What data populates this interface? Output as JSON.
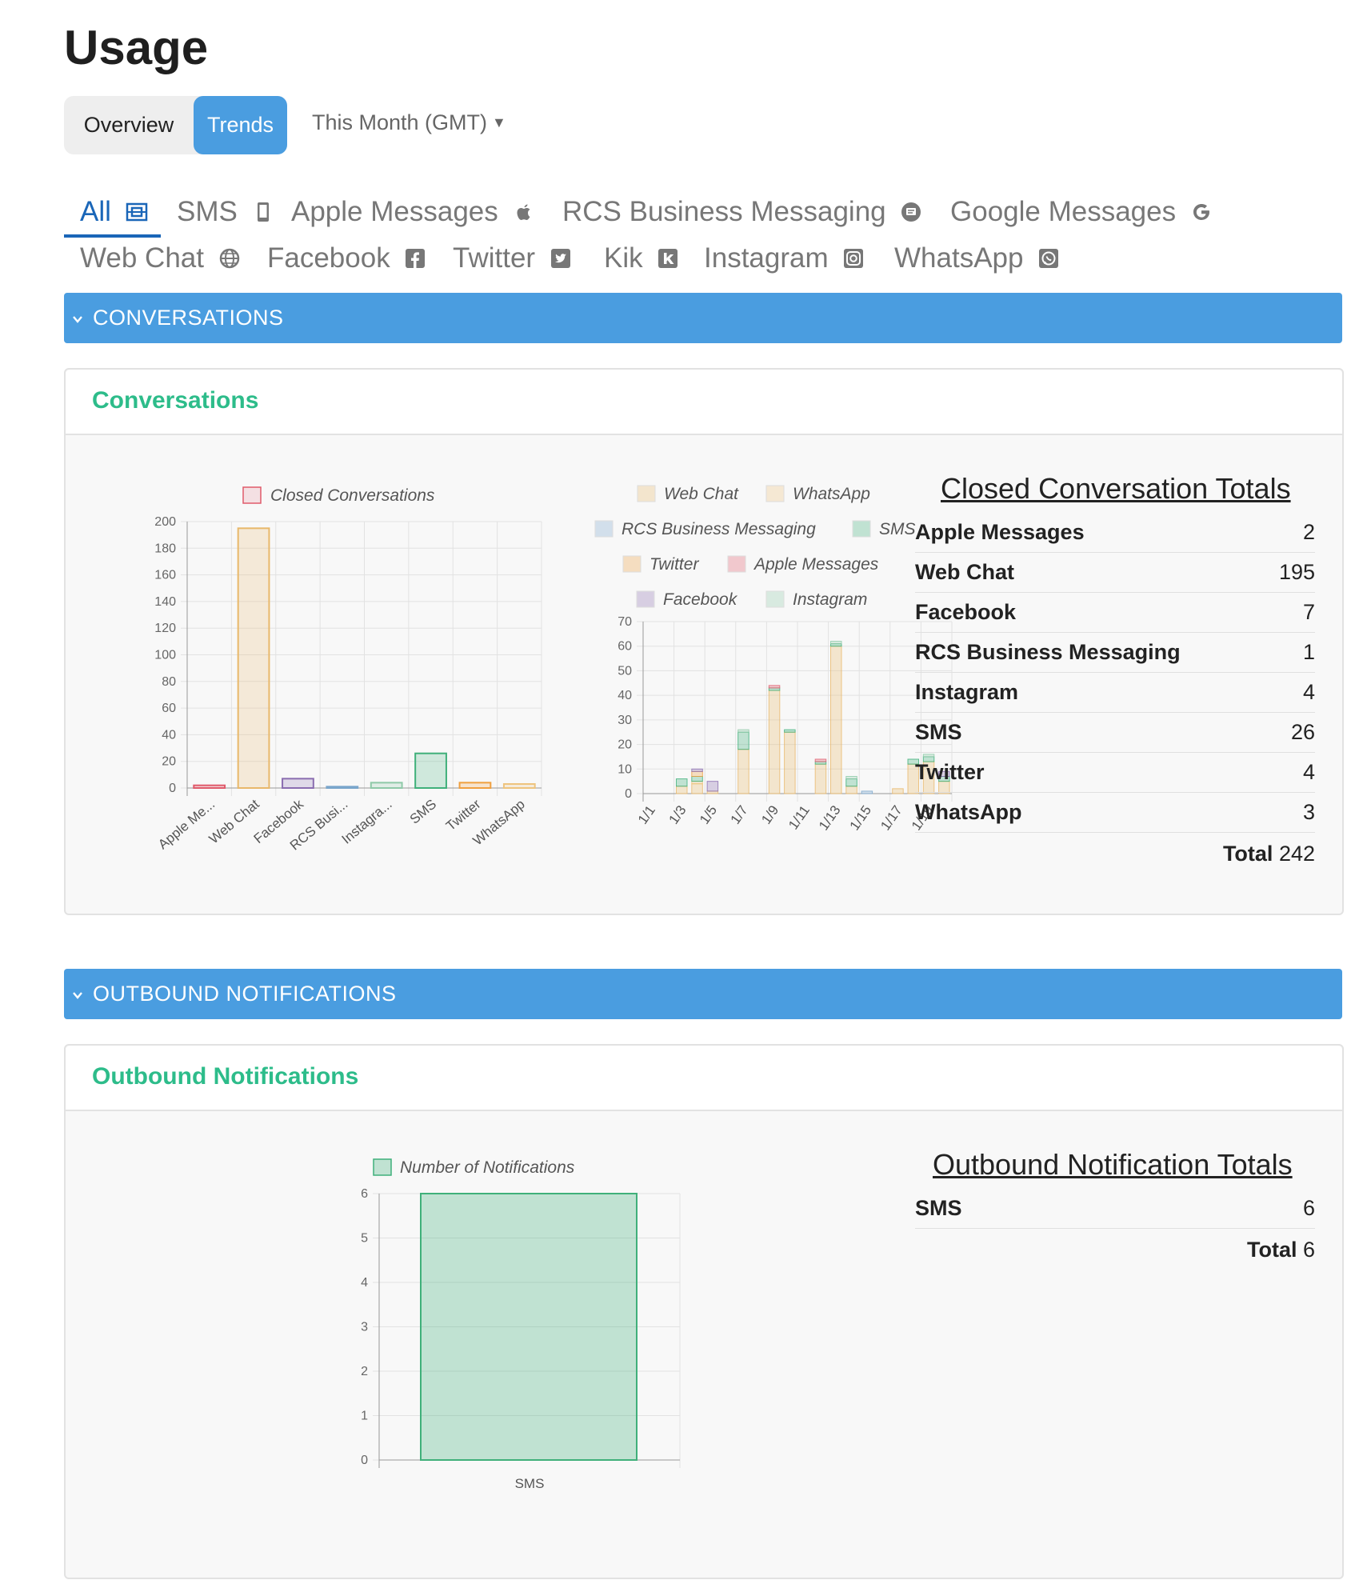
{
  "page_title": "Usage",
  "view_toggle": {
    "overview": "Overview",
    "trends": "Trends",
    "selected": "Trends"
  },
  "date_range": {
    "label": "This Month (GMT)"
  },
  "channel_tabs": [
    {
      "label": "All",
      "icon": "all-icon",
      "active": true
    },
    {
      "label": "SMS",
      "icon": "mobile-icon"
    },
    {
      "label": "Apple Messages",
      "icon": "apple-icon"
    },
    {
      "label": "RCS Business Messaging",
      "icon": "rcs-icon"
    },
    {
      "label": "Google Messages",
      "icon": "google-icon"
    },
    {
      "label": "Web Chat",
      "icon": "globe-icon"
    },
    {
      "label": "Facebook",
      "icon": "facebook-icon"
    },
    {
      "label": "Twitter",
      "icon": "twitter-icon"
    },
    {
      "label": "Kik",
      "icon": "kik-icon"
    },
    {
      "label": "Instagram",
      "icon": "instagram-icon"
    },
    {
      "label": "WhatsApp",
      "icon": "whatsapp-icon"
    }
  ],
  "sections": {
    "conversations": {
      "bar_label": "CONVERSATIONS",
      "card_title": "Conversations",
      "totals": {
        "title": "Closed Conversation Totals",
        "rows": [
          {
            "name": "Apple Messages",
            "value": "2"
          },
          {
            "name": "Web Chat",
            "value": "195"
          },
          {
            "name": "Facebook",
            "value": "7"
          },
          {
            "name": "RCS Business Messaging",
            "value": "1"
          },
          {
            "name": "Instagram",
            "value": "4"
          },
          {
            "name": "SMS",
            "value": "26"
          },
          {
            "name": "Twitter",
            "value": "4"
          },
          {
            "name": "WhatsApp",
            "value": "3"
          }
        ],
        "total_label": "Total",
        "total_value": "242"
      }
    },
    "notifications": {
      "bar_label": "OUTBOUND NOTIFICATIONS",
      "card_title": "Outbound Notifications",
      "totals": {
        "title": "Outbound Notification Totals",
        "rows": [
          {
            "name": "SMS",
            "value": "6"
          }
        ],
        "total_label": "Total",
        "total_value": "6"
      }
    }
  },
  "colors": {
    "accent": "#4a9de0",
    "tab_active": "#1a66b8",
    "card_title": "#2dbc8a",
    "apple_messages": "#e05a6b",
    "web_chat": "#e8b86a",
    "facebook": "#8a6db0",
    "rcs": "#7aa6cc",
    "instagram": "#8fc9a8",
    "sms": "#3fb07a",
    "twitter": "#f0a040",
    "whatsapp": "#eec47e"
  },
  "chart_data": [
    {
      "type": "bar",
      "id": "closed-by-channel",
      "legend": [
        "Closed Conversations"
      ],
      "categories": [
        "Apple Me...",
        "Web Chat",
        "Facebook",
        "RCS Busi...",
        "Instagra...",
        "SMS",
        "Twitter",
        "WhatsApp"
      ],
      "series": [
        {
          "name": "Closed Conversations",
          "values": [
            2,
            195,
            7,
            1,
            4,
            26,
            4,
            3
          ]
        }
      ],
      "ylim": [
        0,
        200
      ],
      "yticks": [
        0,
        20,
        40,
        60,
        80,
        100,
        120,
        140,
        160,
        180,
        200
      ],
      "grid": true,
      "legend_position": "top"
    },
    {
      "type": "bar",
      "stacked": true,
      "id": "daily-closed",
      "x": [
        "1/1",
        "1/2",
        "1/3",
        "1/4",
        "1/5",
        "1/6",
        "1/7",
        "1/8",
        "1/9",
        "1/10",
        "1/11",
        "1/12",
        "1/13",
        "1/14",
        "1/15",
        "1/16",
        "1/17",
        "1/18",
        "1/19",
        "1/20"
      ],
      "xtick_labels": [
        "1/1",
        "1/3",
        "1/5",
        "1/7",
        "1/9",
        "1/11",
        "1/13",
        "1/15",
        "1/17",
        "1/19"
      ],
      "series": [
        {
          "name": "Web Chat",
          "values": [
            0,
            0,
            3,
            4,
            1,
            0,
            18,
            0,
            42,
            25,
            0,
            12,
            60,
            3,
            0,
            0,
            2,
            12,
            13,
            5
          ]
        },
        {
          "name": "WhatsApp",
          "values": [
            0,
            0,
            0,
            1,
            0,
            0,
            0,
            0,
            0,
            0,
            0,
            0,
            0,
            0,
            0,
            0,
            0,
            0,
            0,
            0
          ]
        },
        {
          "name": "RCS Business Messaging",
          "values": [
            0,
            0,
            0,
            0,
            0,
            0,
            0,
            0,
            0,
            0,
            0,
            0,
            0,
            0,
            1,
            0,
            0,
            0,
            0,
            0
          ]
        },
        {
          "name": "SMS",
          "values": [
            0,
            0,
            3,
            2,
            0,
            0,
            7,
            0,
            1,
            1,
            0,
            1,
            1,
            3,
            0,
            0,
            0,
            2,
            2,
            2
          ]
        },
        {
          "name": "Twitter",
          "values": [
            0,
            0,
            0,
            2,
            0,
            0,
            0,
            0,
            0,
            0,
            0,
            0,
            0,
            0,
            0,
            0,
            0,
            0,
            0,
            0
          ]
        },
        {
          "name": "Apple Messages",
          "values": [
            0,
            0,
            0,
            0,
            0,
            0,
            0,
            0,
            1,
            0,
            0,
            1,
            0,
            0,
            0,
            0,
            0,
            0,
            0,
            0
          ]
        },
        {
          "name": "Facebook",
          "values": [
            0,
            0,
            0,
            1,
            4,
            0,
            0,
            0,
            0,
            0,
            0,
            0,
            0,
            0,
            0,
            0,
            0,
            0,
            0,
            2
          ]
        },
        {
          "name": "Instagram",
          "values": [
            0,
            0,
            0,
            0,
            0,
            0,
            1,
            0,
            0,
            0,
            0,
            0,
            1,
            1,
            0,
            0,
            0,
            0,
            1,
            0
          ]
        }
      ],
      "ylim": [
        0,
        70
      ],
      "yticks": [
        0,
        10,
        20,
        30,
        40,
        50,
        60,
        70
      ],
      "grid": true,
      "legend_position": "top"
    },
    {
      "type": "bar",
      "id": "notifications",
      "legend": [
        "Number of Notifications"
      ],
      "categories": [
        "SMS"
      ],
      "series": [
        {
          "name": "Number of Notifications",
          "values": [
            6
          ]
        }
      ],
      "ylim": [
        0,
        6
      ],
      "yticks": [
        0,
        1,
        2,
        3,
        4,
        5,
        6
      ],
      "grid": true,
      "legend_position": "top"
    }
  ]
}
